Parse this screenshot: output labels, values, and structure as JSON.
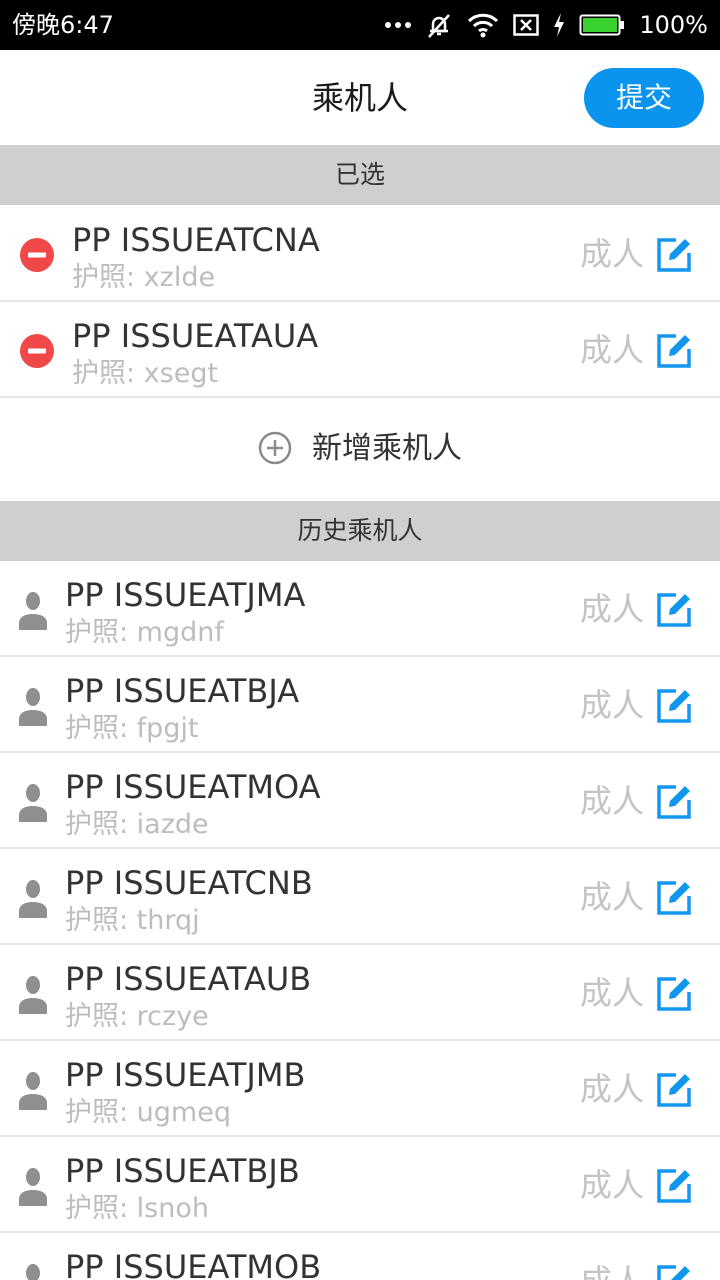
{
  "status_bar": {
    "time": "傍晚6:47",
    "battery": "100%"
  },
  "header": {
    "title": "乘机人",
    "submit_label": "提交"
  },
  "selected_section": {
    "title": "已选",
    "passengers": [
      {
        "name": "PP ISSUEATCNA",
        "passport": "护照: xzlde",
        "type": "成人"
      },
      {
        "name": "PP ISSUEATAUA",
        "passport": "护照: xsegt",
        "type": "成人"
      }
    ]
  },
  "add_passenger_label": "新增乘机人",
  "history_section": {
    "title": "历史乘机人",
    "passengers": [
      {
        "name": "PP ISSUEATJMA",
        "passport": "护照: mgdnf",
        "type": "成人"
      },
      {
        "name": "PP ISSUEATBJA",
        "passport": "护照: fpgjt",
        "type": "成人"
      },
      {
        "name": "PP ISSUEATMOA",
        "passport": "护照: iazde",
        "type": "成人"
      },
      {
        "name": "PP ISSUEATCNB",
        "passport": "护照: thrqj",
        "type": "成人"
      },
      {
        "name": "PP ISSUEATAUB",
        "passport": "护照: rczye",
        "type": "成人"
      },
      {
        "name": "PP ISSUEATJMB",
        "passport": "护照: ugmeq",
        "type": "成人"
      },
      {
        "name": "PP ISSUEATBJB",
        "passport": "护照: lsnoh",
        "type": "成人"
      },
      {
        "name": "PP ISSUEATMOB",
        "passport": "",
        "type": "成人"
      }
    ]
  },
  "icons": {
    "remove": "minus-circle-icon",
    "edit": "edit-icon",
    "person": "person-icon",
    "add": "plus-circle-icon"
  },
  "colors": {
    "accent": "#0a94ee",
    "remove": "#f04848",
    "section_bg": "#cfcfcf",
    "muted_text": "#bdbdbd"
  }
}
